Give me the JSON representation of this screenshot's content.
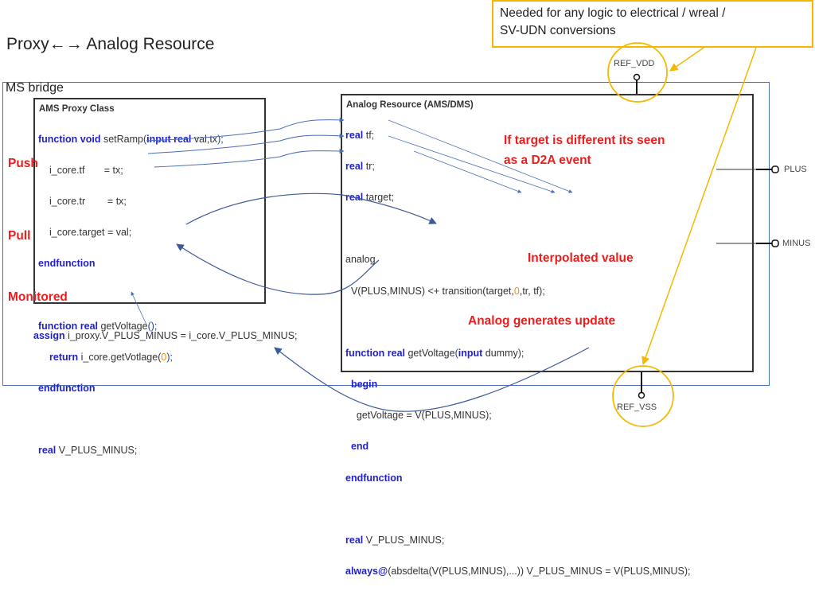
{
  "title": {
    "left": "Proxy",
    "arrow": "←→",
    "right": "Analog Resource"
  },
  "callout": {
    "text_line1": "Needed for any logic to electrical / wreal /",
    "text_line2": "SV-UDN conversions"
  },
  "ms_bridge": {
    "label": "MS bridge"
  },
  "proxy_class": {
    "header": "AMS Proxy Class",
    "lines": {
      "fn_set_kw": "function void ",
      "fn_set_name": "setRamp",
      "fn_set_paren": "(",
      "fn_set_args_kw": "input real ",
      "fn_set_args": "val,tx",
      "fn_set_end": ");",
      "tf": "i_core.tf       = tx;",
      "tr": "i_core.tr        = tx;",
      "target": "i_core.target = val;",
      "endfunction1": "endfunction",
      "fn_get_kw": "function real ",
      "fn_get_name": "getVoltage",
      "fn_get_end": "();",
      "return_kw": "return ",
      "return_expr": "i_core.getVotlage(",
      "return_num": "0",
      "return_end": ");",
      "endfunction2": "endfunction",
      "real_kw": "real ",
      "real_var": "V_PLUS_MINUS;"
    }
  },
  "assign_line": {
    "kw": "assign ",
    "expr": "i_proxy.V_PLUS_MINUS = i_core.V_PLUS_MINUS;"
  },
  "analog_resource": {
    "header": "Analog Resource (AMS/DMS)",
    "lines": {
      "real_tf_kw": "real ",
      "real_tf": "tf;",
      "real_tr_kw": "real ",
      "real_tr": "tr;",
      "real_target_kw": "real ",
      "real_target": "target;",
      "analog": "analog",
      "contrib_a": "  V(PLUS,MINUS) <+ transition(target,",
      "contrib_num": "0",
      "contrib_b": ",tr, tf);",
      "fn_kw": "function real ",
      "fn_name": "getVoltage",
      "fn_paren": "(",
      "fn_input": "input ",
      "fn_arg": "dummy);",
      "begin": "  begin",
      "assign_stmt": "    getVoltage = V(PLUS,MINUS);",
      "end": "  end",
      "endfunction": "endfunction",
      "real_v_kw": "real ",
      "real_v": "V_PLUS_MINUS;",
      "always_kw": "always@",
      "always_expr": "(absdelta(V(PLUS,MINUS),...)) V_PLUS_MINUS = V(PLUS,MINUS);"
    }
  },
  "annotations": {
    "push": "Push",
    "pull": "Pull",
    "monitored": "Monitored",
    "d2a_line1": "If target is different its seen",
    "d2a_line2": "as a D2A event",
    "interpolated": "Interpolated value",
    "analog_update": "Analog generates update"
  },
  "pins": {
    "ref_vdd": "REF_VDD",
    "ref_vss": "REF_VSS",
    "plus": "PLUS",
    "minus": "MINUS"
  },
  "colors": {
    "keyword": "#1f1fd0",
    "annotation_red": "#ee1c1c",
    "callout_gold": "#f5b800",
    "bridge_blue": "#4a6fb5",
    "number_orange": "#f29000"
  }
}
